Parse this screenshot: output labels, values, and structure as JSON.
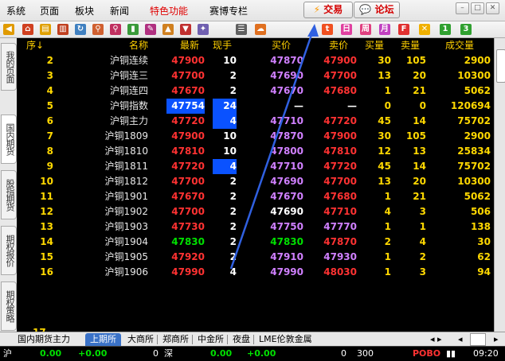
{
  "menu": {
    "items": [
      "系统",
      "页面",
      "板块",
      "新闻",
      "特色功能",
      "赛博专栏"
    ],
    "trade_label": "交易",
    "forum_label": "论坛"
  },
  "left_tabs": [
    "我的页面",
    "国内期货",
    "股指期货",
    "期权报价",
    "期权策略"
  ],
  "table": {
    "headers": [
      "序↓",
      "名称",
      "最新",
      "现手",
      "买价",
      "卖价",
      "买量",
      "卖量",
      "成交量"
    ],
    "rows": [
      {
        "idx": "2",
        "name": "沪铜连续",
        "last": "47900",
        "vol": "10",
        "bid": "47870",
        "ask": "47900",
        "bidq": "30",
        "askq": "105",
        "total": "2900"
      },
      {
        "idx": "3",
        "name": "沪铜连三",
        "last": "47700",
        "vol": "2",
        "bid": "47690",
        "ask": "47700",
        "bidq": "13",
        "askq": "20",
        "total": "10300"
      },
      {
        "idx": "4",
        "name": "沪铜连四",
        "last": "47670",
        "vol": "2",
        "bid": "47670",
        "ask": "47680",
        "bidq": "1",
        "askq": "21",
        "total": "5062"
      },
      {
        "idx": "5",
        "name": "沪铜指数",
        "last": "47754",
        "vol": "24",
        "bid": "—",
        "ask": "—",
        "bidq": "0",
        "askq": "0",
        "total": "120694"
      },
      {
        "idx": "6",
        "name": "沪铜主力",
        "last": "47720",
        "vol": "4",
        "bid": "47710",
        "ask": "47720",
        "bidq": "45",
        "askq": "14",
        "total": "75702"
      },
      {
        "idx": "7",
        "name": "沪铜1809",
        "last": "47900",
        "vol": "10",
        "bid": "47870",
        "ask": "47900",
        "bidq": "30",
        "askq": "105",
        "total": "2900"
      },
      {
        "idx": "8",
        "name": "沪铜1810",
        "last": "47810",
        "vol": "10",
        "bid": "47800",
        "ask": "47810",
        "bidq": "12",
        "askq": "13",
        "total": "25834"
      },
      {
        "idx": "9",
        "name": "沪铜1811",
        "last": "47720",
        "vol": "4",
        "bid": "47710",
        "ask": "47720",
        "bidq": "45",
        "askq": "14",
        "total": "75702"
      },
      {
        "idx": "10",
        "name": "沪铜1812",
        "last": "47700",
        "vol": "2",
        "bid": "47690",
        "ask": "47700",
        "bidq": "13",
        "askq": "20",
        "total": "10300"
      },
      {
        "idx": "11",
        "name": "沪铜1901",
        "last": "47670",
        "vol": "2",
        "bid": "47670",
        "ask": "47680",
        "bidq": "1",
        "askq": "21",
        "total": "5062"
      },
      {
        "idx": "12",
        "name": "沪铜1902",
        "last": "47700",
        "vol": "2",
        "bid": "47690",
        "ask": "47710",
        "bidq": "4",
        "askq": "3",
        "total": "506"
      },
      {
        "idx": "13",
        "name": "沪铜1903",
        "last": "47730",
        "vol": "2",
        "bid": "47750",
        "ask": "47770",
        "bidq": "1",
        "askq": "1",
        "total": "138"
      },
      {
        "idx": "14",
        "name": "沪铜1904",
        "last": "47830",
        "vol": "2",
        "bid": "47830",
        "ask": "47870",
        "bidq": "2",
        "askq": "4",
        "total": "30"
      },
      {
        "idx": "15",
        "name": "沪铜1905",
        "last": "47920",
        "vol": "2",
        "bid": "47910",
        "ask": "47930",
        "bidq": "1",
        "askq": "2",
        "total": "62"
      },
      {
        "idx": "16",
        "name": "沪铜1906",
        "last": "47990",
        "vol": "4",
        "bid": "47990",
        "ask": "48030",
        "bidq": "1",
        "askq": "3",
        "total": "94"
      }
    ]
  },
  "bottom_tabs": [
    "国内期货主力",
    "上期所",
    "大商所",
    "郑商所",
    "中金所",
    "夜盘",
    "LME伦敦金属"
  ],
  "status": {
    "label": "沪",
    "val1": "0.00",
    "val2": "+0.00",
    "val3": "0",
    "label2": "深",
    "val4": "0.00",
    "val5": "+0.00",
    "val6": "0",
    "val7": "300",
    "brand": "POBO",
    "time": "09:20"
  }
}
